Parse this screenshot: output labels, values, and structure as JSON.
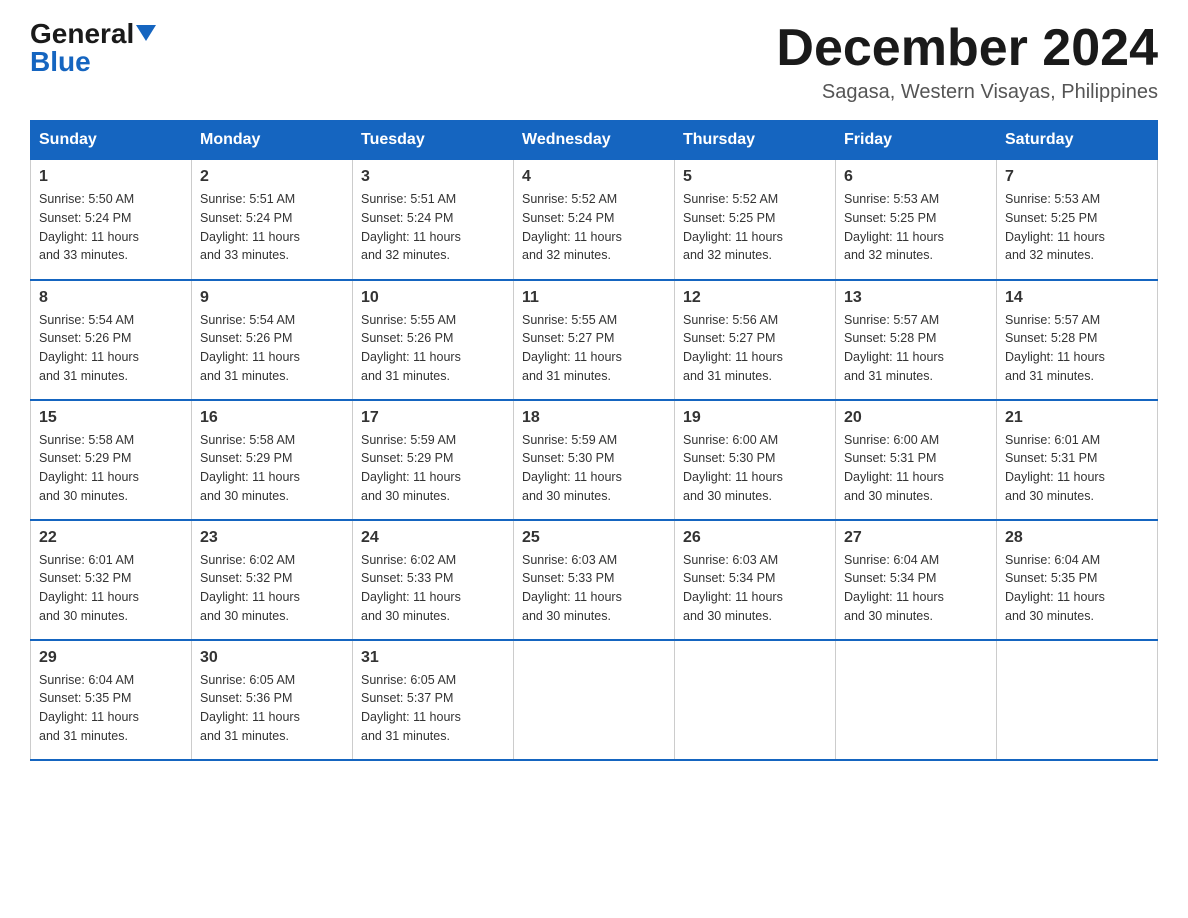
{
  "header": {
    "logo_general": "General",
    "logo_blue": "Blue",
    "month_title": "December 2024",
    "location": "Sagasa, Western Visayas, Philippines"
  },
  "days_of_week": [
    "Sunday",
    "Monday",
    "Tuesday",
    "Wednesday",
    "Thursday",
    "Friday",
    "Saturday"
  ],
  "weeks": [
    [
      {
        "day": "1",
        "info": "Sunrise: 5:50 AM\nSunset: 5:24 PM\nDaylight: 11 hours\nand 33 minutes."
      },
      {
        "day": "2",
        "info": "Sunrise: 5:51 AM\nSunset: 5:24 PM\nDaylight: 11 hours\nand 33 minutes."
      },
      {
        "day": "3",
        "info": "Sunrise: 5:51 AM\nSunset: 5:24 PM\nDaylight: 11 hours\nand 32 minutes."
      },
      {
        "day": "4",
        "info": "Sunrise: 5:52 AM\nSunset: 5:24 PM\nDaylight: 11 hours\nand 32 minutes."
      },
      {
        "day": "5",
        "info": "Sunrise: 5:52 AM\nSunset: 5:25 PM\nDaylight: 11 hours\nand 32 minutes."
      },
      {
        "day": "6",
        "info": "Sunrise: 5:53 AM\nSunset: 5:25 PM\nDaylight: 11 hours\nand 32 minutes."
      },
      {
        "day": "7",
        "info": "Sunrise: 5:53 AM\nSunset: 5:25 PM\nDaylight: 11 hours\nand 32 minutes."
      }
    ],
    [
      {
        "day": "8",
        "info": "Sunrise: 5:54 AM\nSunset: 5:26 PM\nDaylight: 11 hours\nand 31 minutes."
      },
      {
        "day": "9",
        "info": "Sunrise: 5:54 AM\nSunset: 5:26 PM\nDaylight: 11 hours\nand 31 minutes."
      },
      {
        "day": "10",
        "info": "Sunrise: 5:55 AM\nSunset: 5:26 PM\nDaylight: 11 hours\nand 31 minutes."
      },
      {
        "day": "11",
        "info": "Sunrise: 5:55 AM\nSunset: 5:27 PM\nDaylight: 11 hours\nand 31 minutes."
      },
      {
        "day": "12",
        "info": "Sunrise: 5:56 AM\nSunset: 5:27 PM\nDaylight: 11 hours\nand 31 minutes."
      },
      {
        "day": "13",
        "info": "Sunrise: 5:57 AM\nSunset: 5:28 PM\nDaylight: 11 hours\nand 31 minutes."
      },
      {
        "day": "14",
        "info": "Sunrise: 5:57 AM\nSunset: 5:28 PM\nDaylight: 11 hours\nand 31 minutes."
      }
    ],
    [
      {
        "day": "15",
        "info": "Sunrise: 5:58 AM\nSunset: 5:29 PM\nDaylight: 11 hours\nand 30 minutes."
      },
      {
        "day": "16",
        "info": "Sunrise: 5:58 AM\nSunset: 5:29 PM\nDaylight: 11 hours\nand 30 minutes."
      },
      {
        "day": "17",
        "info": "Sunrise: 5:59 AM\nSunset: 5:29 PM\nDaylight: 11 hours\nand 30 minutes."
      },
      {
        "day": "18",
        "info": "Sunrise: 5:59 AM\nSunset: 5:30 PM\nDaylight: 11 hours\nand 30 minutes."
      },
      {
        "day": "19",
        "info": "Sunrise: 6:00 AM\nSunset: 5:30 PM\nDaylight: 11 hours\nand 30 minutes."
      },
      {
        "day": "20",
        "info": "Sunrise: 6:00 AM\nSunset: 5:31 PM\nDaylight: 11 hours\nand 30 minutes."
      },
      {
        "day": "21",
        "info": "Sunrise: 6:01 AM\nSunset: 5:31 PM\nDaylight: 11 hours\nand 30 minutes."
      }
    ],
    [
      {
        "day": "22",
        "info": "Sunrise: 6:01 AM\nSunset: 5:32 PM\nDaylight: 11 hours\nand 30 minutes."
      },
      {
        "day": "23",
        "info": "Sunrise: 6:02 AM\nSunset: 5:32 PM\nDaylight: 11 hours\nand 30 minutes."
      },
      {
        "day": "24",
        "info": "Sunrise: 6:02 AM\nSunset: 5:33 PM\nDaylight: 11 hours\nand 30 minutes."
      },
      {
        "day": "25",
        "info": "Sunrise: 6:03 AM\nSunset: 5:33 PM\nDaylight: 11 hours\nand 30 minutes."
      },
      {
        "day": "26",
        "info": "Sunrise: 6:03 AM\nSunset: 5:34 PM\nDaylight: 11 hours\nand 30 minutes."
      },
      {
        "day": "27",
        "info": "Sunrise: 6:04 AM\nSunset: 5:34 PM\nDaylight: 11 hours\nand 30 minutes."
      },
      {
        "day": "28",
        "info": "Sunrise: 6:04 AM\nSunset: 5:35 PM\nDaylight: 11 hours\nand 30 minutes."
      }
    ],
    [
      {
        "day": "29",
        "info": "Sunrise: 6:04 AM\nSunset: 5:35 PM\nDaylight: 11 hours\nand 31 minutes."
      },
      {
        "day": "30",
        "info": "Sunrise: 6:05 AM\nSunset: 5:36 PM\nDaylight: 11 hours\nand 31 minutes."
      },
      {
        "day": "31",
        "info": "Sunrise: 6:05 AM\nSunset: 5:37 PM\nDaylight: 11 hours\nand 31 minutes."
      },
      null,
      null,
      null,
      null
    ]
  ]
}
